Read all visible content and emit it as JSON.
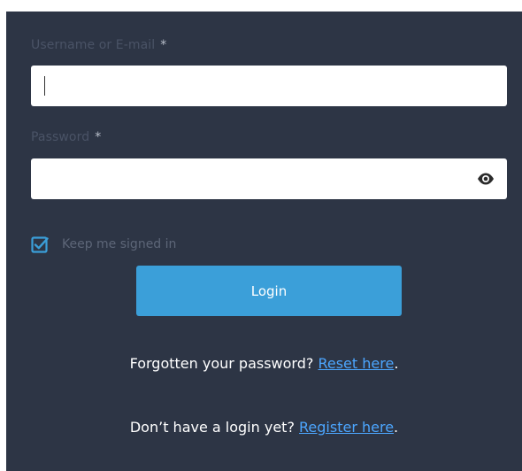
{
  "username": {
    "label": "Username or E-mail",
    "required_mark": "*",
    "value": ""
  },
  "password": {
    "label": "Password",
    "required_mark": "*",
    "value": "",
    "toggle_icon": "eye-icon"
  },
  "remember": {
    "label": "Keep me signed in",
    "checked": true
  },
  "login_button": {
    "label": "Login"
  },
  "forgot": {
    "text": "Forgotten your password?",
    "link": "Reset here",
    "suffix": "."
  },
  "register": {
    "text": "Don’t have a login yet?",
    "link": "Register here",
    "suffix": "."
  },
  "colors": {
    "panel_bg": "#2d3545",
    "button_bg": "#3b9fd9",
    "link": "#4ca6ff",
    "checkbox": "#3b9fd9"
  }
}
